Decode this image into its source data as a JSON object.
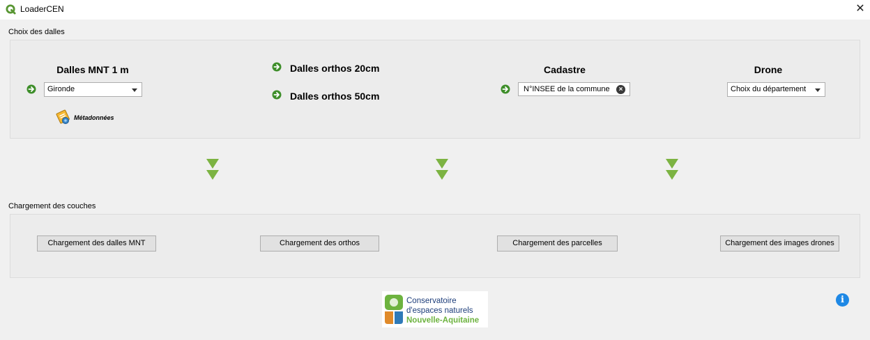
{
  "window": {
    "title": "LoaderCEN"
  },
  "groups": {
    "choix": {
      "label": "Choix des dalles"
    },
    "chargement": {
      "label": "Chargement des couches"
    }
  },
  "mnt": {
    "title": "Dalles MNT 1 m",
    "combo_value": "Gironde",
    "metadata_label": "Métadonnées"
  },
  "orthos": {
    "ortho20_label": "Dalles orthos 20cm",
    "ortho50_label": "Dalles orthos 50cm"
  },
  "cadastre": {
    "title": "Cadastre",
    "insee_value": "N°INSEE de la commune"
  },
  "drone": {
    "title": "Drone",
    "combo_value": "Choix du département"
  },
  "buttons": {
    "load_mnt": "Chargement des dalles MNT",
    "load_orthos": "Chargement des orthos",
    "load_parcelles": "Chargement des parcelles",
    "load_drones": "Chargement des images drones"
  },
  "logo": {
    "line1": "Conservatoire",
    "line2": "d'espaces naturels",
    "line3": "Nouvelle-Aquitaine"
  },
  "colors": {
    "accent_green": "#3e8e2a",
    "chevron_green": "#7cb342",
    "info_blue": "#1e88e5",
    "logo_blue": "#1d3d7a",
    "logo_green": "#6db33f"
  },
  "icons": {
    "app": "qgis-icon",
    "close": "close-icon",
    "go": "green-arrow-icon",
    "metadata": "metadata-icon",
    "flow": "chevron-down-icon",
    "info": "info-icon"
  }
}
